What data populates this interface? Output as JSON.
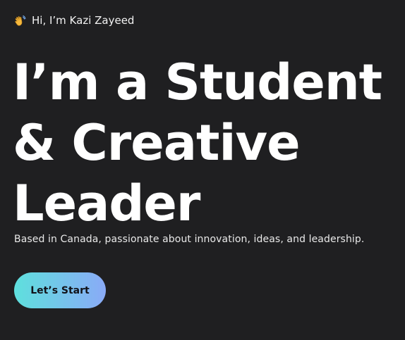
{
  "hero": {
    "greeting": "Hi, I’m Kazi Zayeed",
    "greeting_icon": "waving-hand-icon",
    "headline_lines": [
      "I’m a Student",
      "& Creative",
      "Leader"
    ],
    "tagline": "Based in Canada, passionate about innovation, ideas, and leadership.",
    "cta_label": "Let’s Start"
  },
  "colors": {
    "background": "#1f1f21",
    "text": "#ffffff",
    "button_gradient_start": "#5ee0dd",
    "button_gradient_end": "#8aaaf7",
    "button_text": "#111319"
  }
}
